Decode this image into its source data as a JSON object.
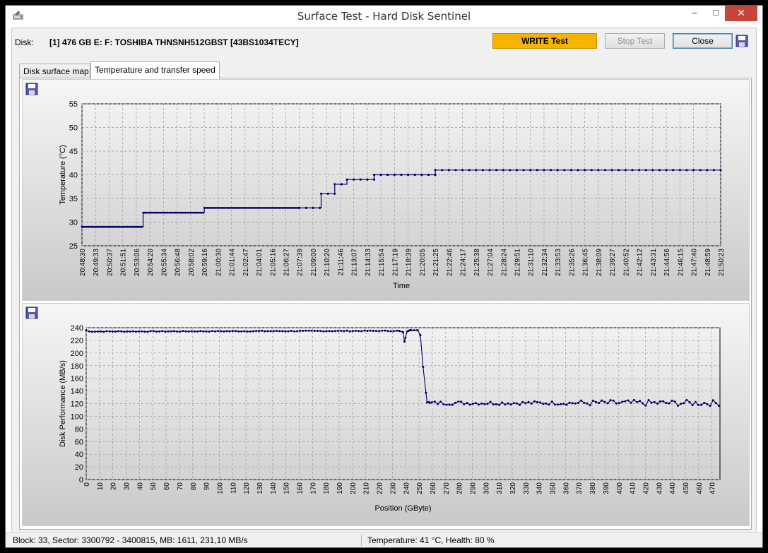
{
  "window": {
    "title": "Surface Test - Hard Disk Sentinel",
    "minimize_glyph": "–",
    "maximize_glyph": "□",
    "close_glyph": "✕"
  },
  "header": {
    "disk_label": "Disk:",
    "disk_value": "[1] 476 GB E: F: TOSHIBA THNSNH512GBST [43BS1034TECY]",
    "write_test_label": "WRITE Test",
    "stop_test_label": "Stop Test",
    "close_label": "Close"
  },
  "tabs": [
    {
      "label": "Disk surface map",
      "active": false
    },
    {
      "label": "Temperature and transfer speed",
      "active": true
    }
  ],
  "icons": {
    "app": "hdd-sentinel-icon",
    "save": "floppy-disk-icon"
  },
  "colors": {
    "write_button": "#f6b400",
    "series_line": "#000066",
    "close_button": "#c7443a"
  },
  "chart_data": [
    {
      "type": "line",
      "xlabel": "Time",
      "ylabel": "Temperature (°C)",
      "ylim": [
        25,
        55
      ],
      "yticks": [
        25,
        30,
        35,
        40,
        45,
        50,
        55
      ],
      "grid": true,
      "x_tick_labels": [
        "20:48:30",
        "20:49:33",
        "20:50:37",
        "20:51:51",
        "20:53:06",
        "20:54:20",
        "20:55:34",
        "20:56:48",
        "20:58:02",
        "20:59:16",
        "21:00:30",
        "21:01:44",
        "21:02:47",
        "21:04:01",
        "21:05:16",
        "21:06:27",
        "21:07:39",
        "21:09:00",
        "21:10:20",
        "21:11:46",
        "21:13:07",
        "21:14:33",
        "21:15:54",
        "21:17:19",
        "21:18:39",
        "21:20:05",
        "21:21:25",
        "21:22:46",
        "21:24:17",
        "21:25:38",
        "21:27:04",
        "21:28:24",
        "21:29:51",
        "21:31:10",
        "21:32:34",
        "21:33:53",
        "21:35:26",
        "21:36:45",
        "21:38:09",
        "21:39:27",
        "21:40:52",
        "21:42:12",
        "21:43:31",
        "21:44:56",
        "21:46:15",
        "21:47:40",
        "21:48:59",
        "21:50:23"
      ],
      "series": [
        {
          "values": [
            {
              "from": 0,
              "to": 4.5,
              "y": 29
            },
            {
              "from": 4.5,
              "to": 9,
              "y": 32
            },
            {
              "from": 9,
              "to": 16,
              "y": 33
            },
            {
              "from": 16,
              "to": 17.6,
              "y": 33
            },
            {
              "from": 17.6,
              "to": 18.6,
              "y": 36
            },
            {
              "from": 18.6,
              "to": 19.5,
              "y": 38
            },
            {
              "from": 19.5,
              "to": 21.5,
              "y": 39
            },
            {
              "from": 21.5,
              "to": 26,
              "y": 40
            },
            {
              "from": 26,
              "to": 47,
              "y": 41
            }
          ]
        }
      ]
    },
    {
      "type": "line",
      "xlabel": "Position (GByte)",
      "ylabel": "Disk Performance (MB/s)",
      "ylim": [
        0,
        240
      ],
      "yticks": [
        0,
        20,
        40,
        60,
        80,
        100,
        120,
        140,
        160,
        180,
        200,
        220,
        240
      ],
      "xlim": [
        0,
        476
      ],
      "xticks": [
        0,
        10,
        20,
        30,
        40,
        50,
        60,
        70,
        80,
        90,
        100,
        110,
        120,
        130,
        140,
        150,
        160,
        170,
        180,
        190,
        200,
        210,
        220,
        230,
        240,
        250,
        260,
        270,
        280,
        290,
        300,
        310,
        320,
        330,
        340,
        350,
        360,
        370,
        380,
        390,
        400,
        410,
        420,
        430,
        440,
        450,
        460,
        470
      ],
      "grid": true,
      "series": [
        {
          "points": [
            [
              0,
              236
            ],
            [
              2,
              234
            ],
            [
              235,
              235
            ],
            [
              238,
              233
            ],
            [
              239,
              218
            ],
            [
              241,
              234
            ],
            [
              243,
              236
            ],
            [
              249,
              236
            ],
            [
              251,
              228
            ],
            [
              253,
              178
            ],
            [
              256,
              122
            ],
            [
              258,
              121
            ],
            [
              476,
              121
            ]
          ],
          "noise_from_gb": 257,
          "noise_amplitude": 6
        }
      ]
    }
  ],
  "status": {
    "left": "Block: 33, Sector: 3300792 - 3400815, MB: 1611, 231,10 MB/s",
    "right": "Temperature: 41  °C, Health: 80 %"
  }
}
